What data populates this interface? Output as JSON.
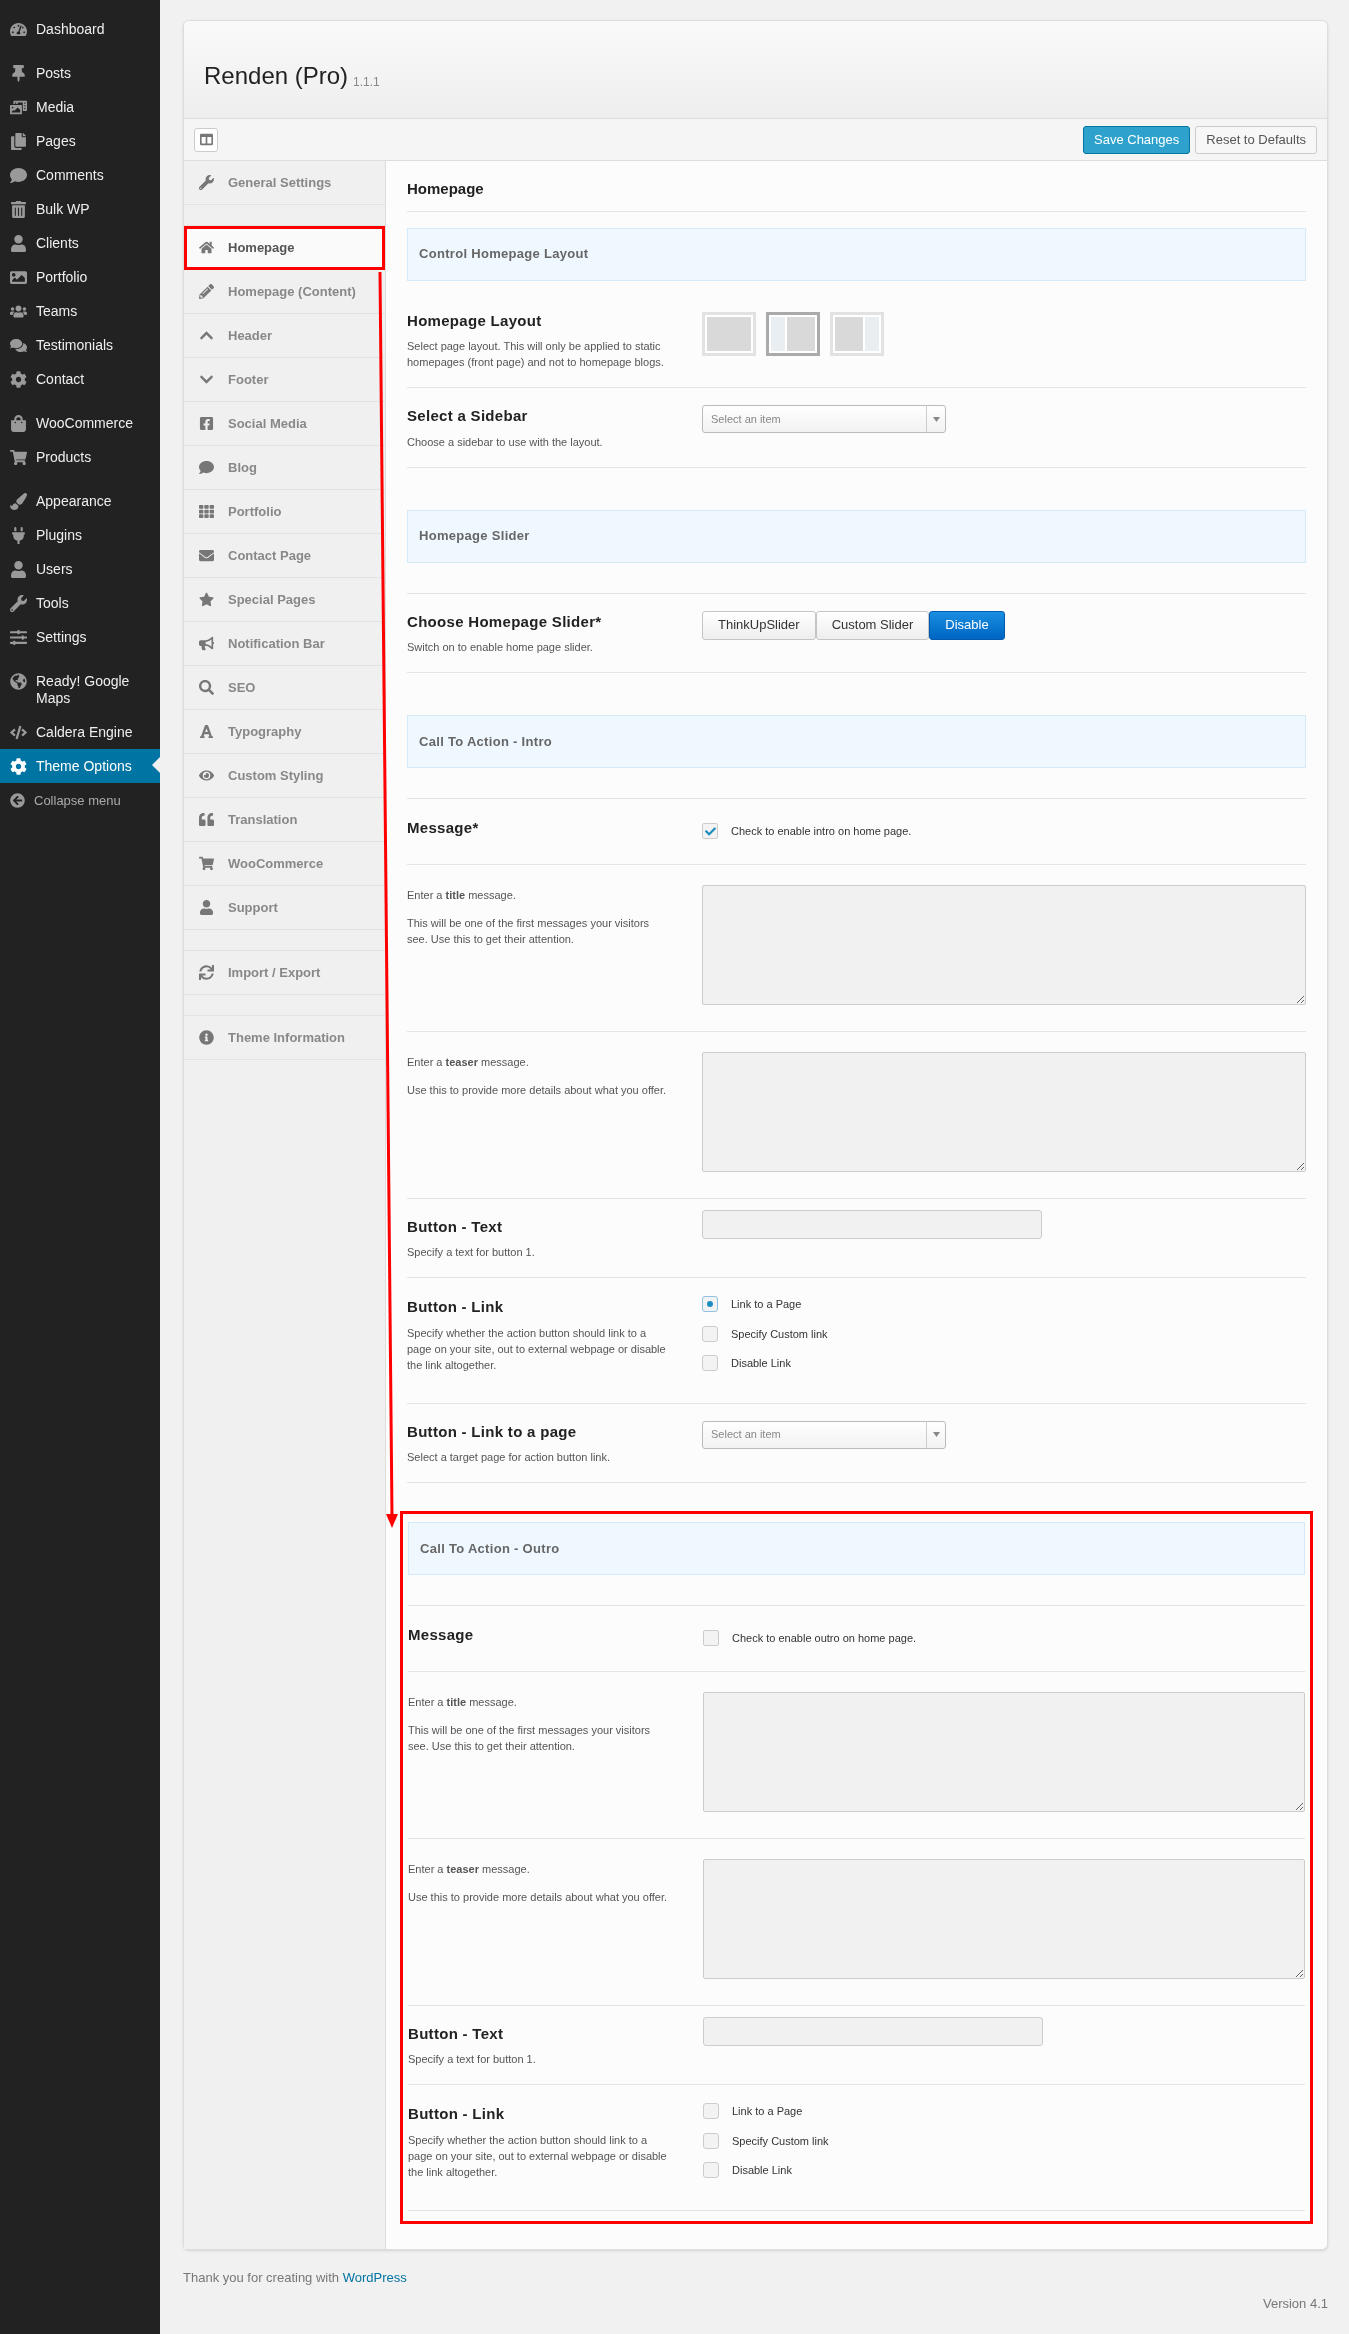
{
  "admin_menu": [
    [
      {
        "label": "Dashboard",
        "selected": false
      }
    ],
    [
      {
        "label": "Posts",
        "selected": false
      },
      {
        "label": "Media",
        "selected": false
      },
      {
        "label": "Pages",
        "selected": false
      },
      {
        "label": "Comments",
        "selected": false
      },
      {
        "label": "Bulk WP",
        "selected": false
      },
      {
        "label": "Clients",
        "selected": false
      },
      {
        "label": "Portfolio",
        "selected": false
      },
      {
        "label": "Teams",
        "selected": false
      },
      {
        "label": "Testimonials",
        "selected": false
      },
      {
        "label": "Contact",
        "selected": false
      }
    ],
    [
      {
        "label": "WooCommerce",
        "selected": false
      },
      {
        "label": "Products",
        "selected": false
      }
    ],
    [
      {
        "label": "Appearance",
        "selected": false
      },
      {
        "label": "Plugins",
        "selected": false
      },
      {
        "label": "Users",
        "selected": false
      },
      {
        "label": "Tools",
        "selected": false
      },
      {
        "label": "Settings",
        "selected": false
      }
    ],
    [
      {
        "label": "Ready! Google Maps",
        "selected": false
      },
      {
        "label": "Caldera Engine",
        "selected": false
      },
      {
        "label": "Theme Options",
        "selected": true
      }
    ]
  ],
  "collapse_menu": "Collapse menu",
  "panel": {
    "title": "Renden (Pro)",
    "version": "1.1.1",
    "buttons": [
      {
        "label": "Save Changes",
        "kind": "primary"
      },
      {
        "label": "Reset to Defaults",
        "kind": "secondary"
      }
    ]
  },
  "options_nav": [
    [
      {
        "label": "General Settings",
        "selected": false,
        "annotated": false
      }
    ],
    [
      {
        "label": "Homepage",
        "selected": true,
        "annotated": true
      },
      {
        "label": "Homepage (Content)",
        "selected": false,
        "annotated": false
      },
      {
        "label": "Header",
        "selected": false,
        "annotated": false
      },
      {
        "label": "Footer",
        "selected": false,
        "annotated": false
      },
      {
        "label": "Social Media",
        "selected": false,
        "annotated": false
      },
      {
        "label": "Blog",
        "selected": false,
        "annotated": false
      },
      {
        "label": "Portfolio",
        "selected": false,
        "annotated": false
      },
      {
        "label": "Contact Page",
        "selected": false,
        "annotated": false
      },
      {
        "label": "Special Pages",
        "selected": false,
        "annotated": false
      },
      {
        "label": "Notification Bar",
        "selected": false,
        "annotated": false
      },
      {
        "label": "SEO",
        "selected": false,
        "annotated": false
      },
      {
        "label": "Typography",
        "selected": false,
        "annotated": false
      },
      {
        "label": "Custom Styling",
        "selected": false,
        "annotated": false
      },
      {
        "label": "Translation",
        "selected": false,
        "annotated": false
      },
      {
        "label": "WooCommerce",
        "selected": false,
        "annotated": false
      },
      {
        "label": "Support",
        "selected": false,
        "annotated": false
      }
    ],
    [
      {
        "label": "Import / Export",
        "selected": false,
        "annotated": false
      }
    ],
    [
      {
        "label": "Theme Information",
        "selected": false,
        "annotated": false
      }
    ]
  ],
  "content": {
    "heading": "Homepage",
    "groups": [
      {
        "annotated": false,
        "rows": [
          {
            "kind": "band",
            "title": "Control Homepage Layout"
          },
          {
            "kind": "layout",
            "label": "Homepage Layout",
            "desc": [
              "Select page layout. This will only be applied to static homepages (front page) and not to homepage blogs."
            ],
            "options": [
              {
                "selected": false
              },
              {
                "selected": true
              },
              {
                "selected": false
              }
            ]
          },
          {
            "kind": "select",
            "label": "Select a Sidebar",
            "desc": [
              "Choose a sidebar to use with the layout."
            ],
            "placeholder": "Select an item"
          },
          {
            "kind": "band",
            "title": "Homepage Slider"
          },
          {
            "kind": "segmented",
            "label": "Choose Homepage Slider*",
            "desc": [
              "Switch on to enable home page slider."
            ],
            "options": [
              {
                "label": "ThinkUpSlider",
                "selected": false
              },
              {
                "label": "Custom Slider",
                "selected": false
              },
              {
                "label": "Disable",
                "selected": true
              }
            ]
          },
          {
            "kind": "band",
            "title": "Call To Action - Intro"
          },
          {
            "kind": "checkbox",
            "label": "Message*",
            "text": "Check to enable intro on home page.",
            "checked": true
          },
          {
            "kind": "textarea",
            "desc": [
              "Enter a **title** message.",
              "This will be one of the first messages your visitors see. Use this to get their attention."
            ]
          },
          {
            "kind": "textarea",
            "desc": [
              "Enter a **teaser** message.",
              "Use this to provide more details about what you offer."
            ]
          },
          {
            "kind": "text",
            "label": "Button - Text",
            "desc": [
              "Specify a text for button 1."
            ]
          },
          {
            "kind": "radio",
            "label": "Button - Link",
            "desc": [
              "Specify whether the action button should link to a page on your site, out to external webpage or disable the link altogether."
            ],
            "options": [
              {
                "label": "Link to a Page",
                "selected": true
              },
              {
                "label": "Specify Custom link",
                "selected": false
              },
              {
                "label": "Disable Link",
                "selected": false
              }
            ]
          },
          {
            "kind": "select",
            "label": "Button - Link to a page",
            "desc": [
              "Select a target page for action button link."
            ],
            "placeholder": "Select an item"
          }
        ]
      },
      {
        "annotated": true,
        "rows": [
          {
            "kind": "band",
            "title": "Call To Action - Outro"
          },
          {
            "kind": "checkbox",
            "label": "Message",
            "text": "Check to enable outro on home page.",
            "checked": false
          },
          {
            "kind": "textarea",
            "desc": [
              "Enter a **title** message.",
              "This will be one of the first messages your visitors see. Use this to get their attention."
            ]
          },
          {
            "kind": "textarea",
            "desc": [
              "Enter a **teaser** message.",
              "Use this to provide more details about what you offer."
            ]
          },
          {
            "kind": "text",
            "label": "Button - Text",
            "desc": [
              "Specify a text for button 1."
            ]
          },
          {
            "kind": "radio",
            "label": "Button - Link",
            "desc": [
              "Specify whether the action button should link to a page on your site, out to external webpage or disable the link altogether."
            ],
            "options": [
              {
                "label": "Link to a Page",
                "selected": false
              },
              {
                "label": "Specify Custom link",
                "selected": false
              },
              {
                "label": "Disable Link",
                "selected": false
              }
            ]
          }
        ]
      }
    ]
  },
  "footer": {
    "text": "Thank you for creating with",
    "link": "WordPress",
    "version": "Version 4.1"
  }
}
